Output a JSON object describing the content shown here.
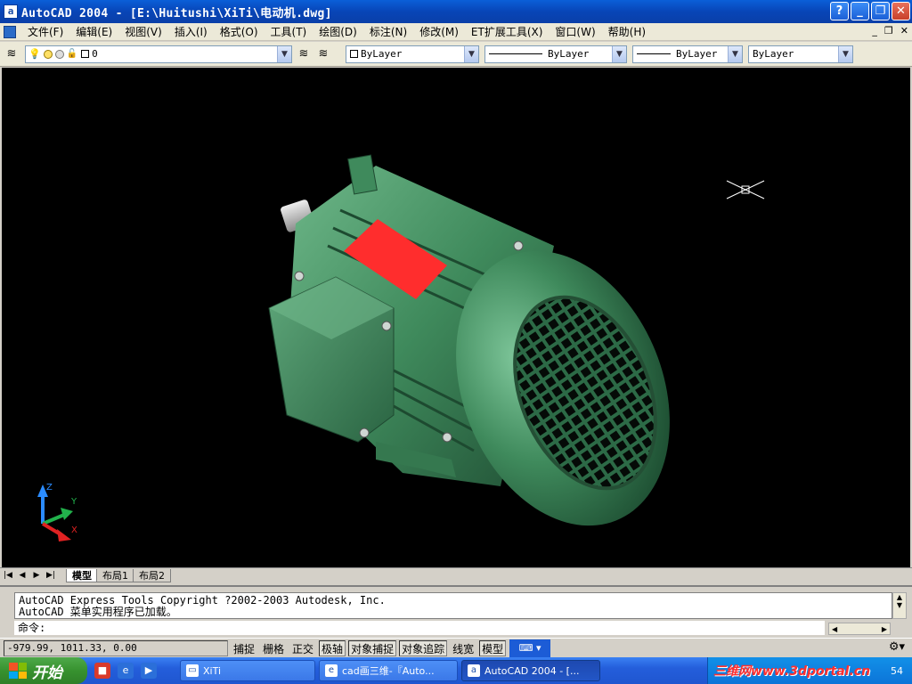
{
  "window": {
    "app_icon": "a",
    "title": "AutoCAD 2004 - [E:\\Huitushi\\XiTi\\电动机.dwg]",
    "buttons": [
      "?",
      "_",
      "❐",
      "✕"
    ]
  },
  "menubar": {
    "items": [
      "文件(F)",
      "编辑(E)",
      "视图(V)",
      "插入(I)",
      "格式(O)",
      "工具(T)",
      "绘图(D)",
      "标注(N)",
      "修改(M)",
      "ET扩展工具(X)",
      "窗口(W)",
      "帮助(H)"
    ],
    "mdi_buttons": [
      "_",
      "❐",
      "✕"
    ]
  },
  "toolbar": {
    "layer_name": "0",
    "color": "ByLayer",
    "linetype": "ByLayer",
    "lineweight": "ByLayer",
    "plotstyle": "ByLayer"
  },
  "layout_tabs": {
    "tabs": [
      "模型",
      "布局1",
      "布局2"
    ]
  },
  "command": {
    "history": [
      "AutoCAD Express Tools Copyright ?2002-2003 Autodesk, Inc.",
      "AutoCAD 菜单实用程序已加载。"
    ],
    "prompt": "命令:"
  },
  "statusbar": {
    "coordinates": "-979.99,  1011.33, 0.00",
    "buttons": [
      {
        "label": "捕捉",
        "on": false
      },
      {
        "label": "栅格",
        "on": false
      },
      {
        "label": "正交",
        "on": false
      },
      {
        "label": "极轴",
        "on": true
      },
      {
        "label": "对象捕捉",
        "on": true
      },
      {
        "label": "对象追踪",
        "on": true
      },
      {
        "label": "线宽",
        "on": false
      },
      {
        "label": "模型",
        "on": true
      }
    ]
  },
  "ucs": {
    "x": "X",
    "y": "Y",
    "z": "Z"
  },
  "taskbar": {
    "start_label": "开始",
    "tasks": [
      {
        "label": "XiTi",
        "active": false
      },
      {
        "label": "cad画三维-『Auto...",
        "active": false
      },
      {
        "label": "AutoCAD 2004 - [...",
        "active": true
      }
    ],
    "watermark": "三维网www.3dportal.cn",
    "clock": "54"
  },
  "colors": {
    "motor_green": "#3f8a5c",
    "nameplate_red": "#ff2d2d",
    "canvas": "#000000"
  }
}
